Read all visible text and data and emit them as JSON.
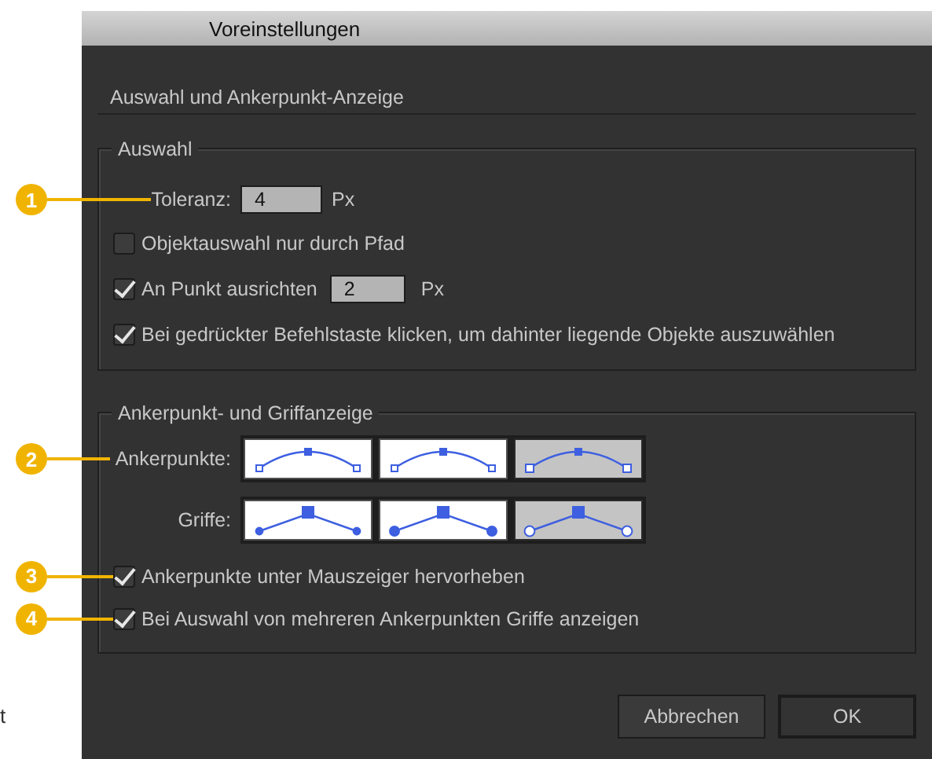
{
  "window": {
    "title": "Voreinstellungen"
  },
  "section_title": "Auswahl und Ankerpunkt-Anzeige",
  "selection": {
    "legend": "Auswahl",
    "tolerance": {
      "label": "Toleranz:",
      "value": "4",
      "unit": "Px",
      "callout": "1"
    },
    "options": [
      {
        "kind": "checkbox",
        "label": "Objektauswahl nur durch Pfad",
        "checked": false
      },
      {
        "kind": "checkbox-field",
        "label": "An Punkt ausrichten",
        "checked": true,
        "value": "2",
        "unit": "Px"
      },
      {
        "kind": "checkbox",
        "label": "Bei gedrückter Befehlstaste klicken, um dahinter liegende Objekte auszuwählen",
        "checked": true
      }
    ]
  },
  "anchor_display": {
    "legend": "Ankerpunkt- und Griffanzeige",
    "rows": [
      {
        "kind": "anchor",
        "label": "Ankerpunkte:",
        "callout": "2",
        "choices": [
          {
            "selected": false
          },
          {
            "selected": false
          },
          {
            "selected": true
          }
        ]
      },
      {
        "kind": "handle",
        "label": "Griffe:",
        "choices": [
          {
            "selected": false
          },
          {
            "selected": false
          },
          {
            "selected": true
          }
        ]
      }
    ],
    "options": [
      {
        "kind": "checkbox",
        "label": "Ankerpunkte unter Mauszeiger hervorheben",
        "checked": true,
        "callout": "3"
      },
      {
        "kind": "checkbox",
        "label": "Bei Auswahl von mehreren Ankerpunkten Griffe anzeigen",
        "checked": true,
        "callout": "4"
      }
    ]
  },
  "buttons": [
    {
      "label": "Abbrechen",
      "default": false
    },
    {
      "label": "OK",
      "default": true
    }
  ],
  "margin_text": "t"
}
